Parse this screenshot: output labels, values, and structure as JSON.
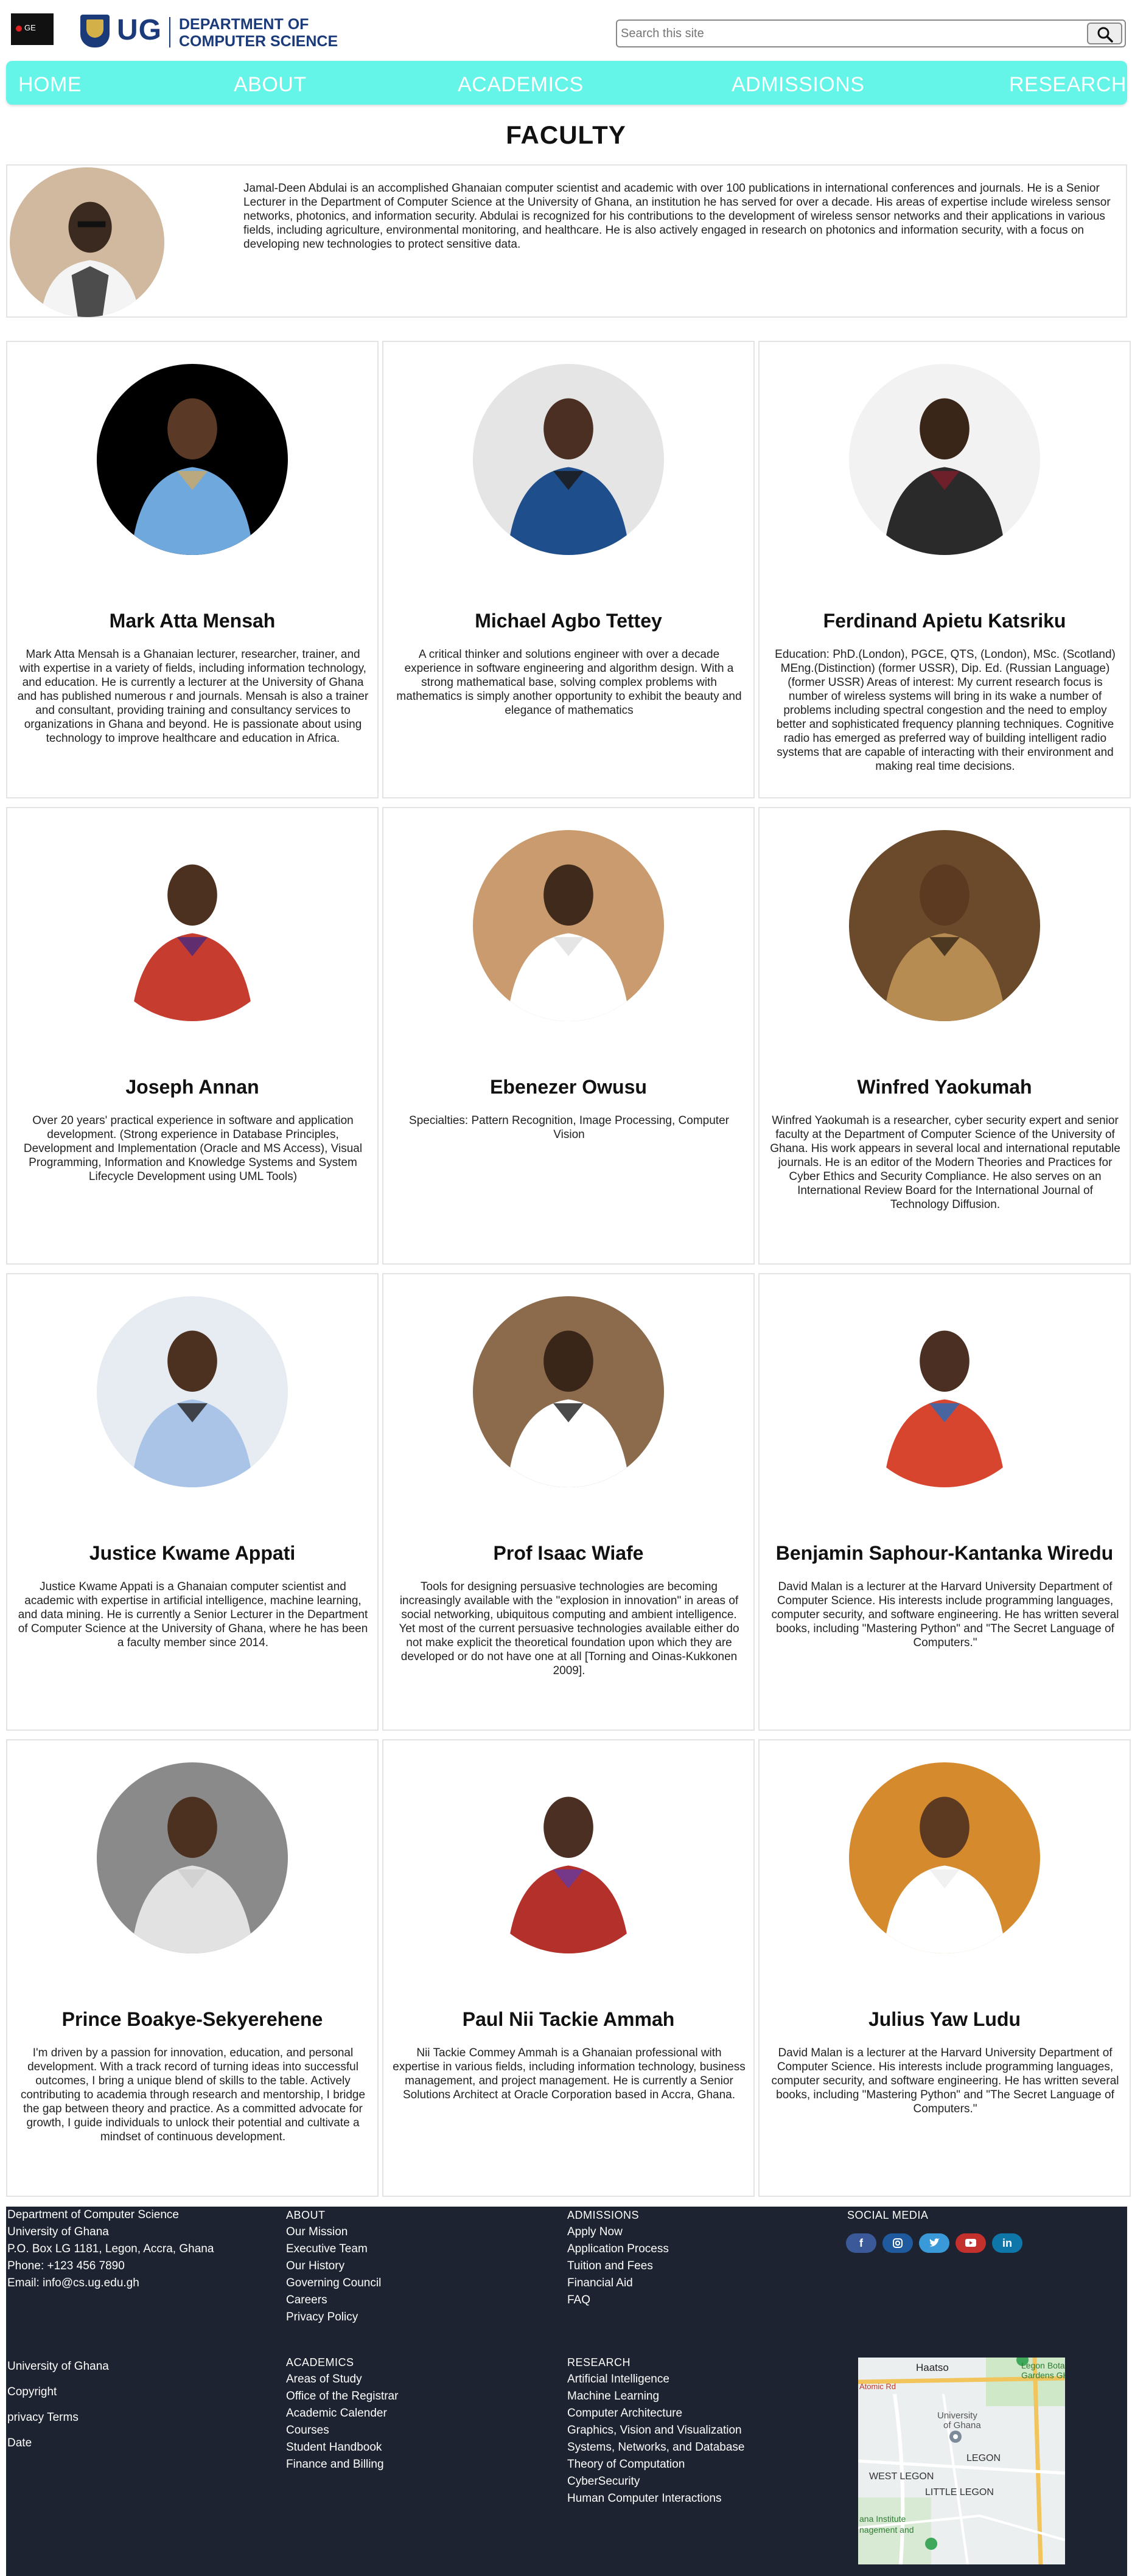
{
  "header": {
    "logo_badge": "GE",
    "ug": "UG",
    "dept_line1": "DEPARTMENT OF",
    "dept_line2": "COMPUTER SCIENCE",
    "search_placeholder": "Search this site"
  },
  "nav": {
    "items": [
      {
        "label": "HOME"
      },
      {
        "label": "ABOUT"
      },
      {
        "label": "ACADEMICS"
      },
      {
        "label": "ADMISSIONS"
      },
      {
        "label": "RESEARCH"
      }
    ]
  },
  "page_title": "FACULTY",
  "featured": {
    "bio": "Jamal-Deen Abdulai is an accomplished Ghanaian computer scientist and academic with over 100 publications in international conferences and journals. He is a Senior Lecturer in the Department of Computer Science at the University of Ghana, an institution he has served for over a decade. His areas of expertise include wireless sensor networks, photonics, and information security. Abdulai is recognized for his contributions to the development of wireless sensor networks and their applications in various fields, including agriculture, environmental monitoring, and healthcare. He is also actively engaged in research on photonics and information security, with a focus on developing new technologies to protect sensitive data."
  },
  "faculty": [
    {
      "name": "Mark Atta Mensah",
      "bio": "Mark Atta Mensah is a Ghanaian lecturer, researcher, trainer, and with expertise in a variety of fields, including information technology, and education. He is currently a lecturer at the University of Ghana and has published numerous r and journals. Mensah is also a trainer and consultant, providing training and consultancy services to organizations in Ghana and beyond. He is passionate about using technology to improve healthcare and education in Africa."
    },
    {
      "name": "Michael Agbo Tettey",
      "bio": "A critical thinker and solutions engineer with over a decade experience in software engineering and algorithm design. With a strong mathematical base, solving complex problems with mathematics is simply another opportunity to exhibit the beauty and elegance of mathematics"
    },
    {
      "name": "Ferdinand Apietu Katsriku",
      "bio": "Education: PhD.(London), PGCE, QTS, (London), MSc. (Scotland) MEng.(Distinction) (former USSR), Dip. Ed. (Russian Language) (former USSR) Areas of interest: My current research focus is number of wireless systems will bring in its wake a number of problems including spectral congestion and the need to employ better and sophisticated frequency planning techniques. Cognitive radio has emerged as preferred way of building intelligent radio systems that are capable of interacting with their environment and making real time decisions."
    },
    {
      "name": "Joseph Annan",
      "bio": "Over 20 years' practical experience in software and application development. (Strong experience in Database Principles, Development and Implementation (Oracle and MS Access), Visual Programming, Information and Knowledge Systems and System Lifecycle Development using UML Tools)"
    },
    {
      "name": "Ebenezer Owusu",
      "bio": "Specialties: Pattern Recognition, Image Processing, Computer Vision"
    },
    {
      "name": "Winfred Yaokumah",
      "bio": "Winfred Yaokumah is a researcher, cyber security expert and senior faculty at the Department of Computer Science of the University of Ghana. His work appears in several local and international reputable journals. He is an editor of the Modern Theories and Practices for Cyber Ethics and Security Compliance. He also serves on an International Review Board for the International Journal of Technology Diffusion."
    },
    {
      "name": "Justice Kwame Appati",
      "bio": "Justice Kwame Appati is a Ghanaian computer scientist and academic with expertise in artificial intelligence, machine learning, and data mining. He is currently a Senior Lecturer in the Department of Computer Science at the University of Ghana, where he has been a faculty member since 2014."
    },
    {
      "name": "Prof Isaac Wiafe",
      "bio": "Tools for designing persuasive technologies are becoming increasingly available with the \"explosion in innovation\" in areas of social networking, ubiquitous computing and ambient intelligence. Yet most of the current persuasive technologies available either do not make explicit the theoretical foundation upon which they are developed or do not have one at all [Torning and Oinas-Kukkonen 2009]."
    },
    {
      "name": "Benjamin Saphour-Kantanka Wiredu",
      "bio": "David Malan is a lecturer at the Harvard University Department of Computer Science. His interests include programming languages, computer security, and software engineering. He has written several books, including \"Mastering Python\" and \"The Secret Language of Computers.\""
    },
    {
      "name": "Prince Boakye-Sekyerehene",
      "bio": "I'm driven by a passion for innovation, education, and personal development. With a track record of turning ideas into successful outcomes, I bring a unique blend of skills to the table. Actively contributing to academia through research and mentorship, I bridge the gap between theory and practice. As a committed advocate for growth, I guide individuals to unlock their potential and cultivate a mindset of continuous development."
    },
    {
      "name": "Paul Nii Tackie Ammah",
      "bio": "Nii Tackie Commey Ammah is a Ghanaian professional with expertise in various fields, including information technology, business management, and project management. He is currently a Senior Solutions Architect at Oracle Corporation based in Accra, Ghana."
    },
    {
      "name": "Julius Yaw Ludu",
      "bio": "David Malan is a lecturer at the Harvard University Department of Computer Science. His interests include programming languages, computer security, and software engineering. He has written several books, including \"Mastering Python\" and \"The Secret Language of Computers.\""
    }
  ],
  "footer": {
    "contact": [
      "Department of Computer Science",
      "University of Ghana",
      "P.O. Box LG 1181, Legon, Accra, Ghana",
      "Phone: +123 456 7890",
      "Email: info@cs.ug.edu.gh"
    ],
    "about_heading": "ABOUT",
    "about_links": [
      "Our Mission",
      "Executive Team",
      "Our History",
      "Governing Council",
      "Careers",
      "Privacy Policy"
    ],
    "admissions_heading": "ADMISSIONS",
    "admissions_links": [
      "Apply Now",
      "Application Process",
      "Tuition and Fees",
      "Financial Aid",
      "FAQ"
    ],
    "social_heading": "SOCIAL MEDIA",
    "legal": [
      "University of Ghana",
      "Copyright",
      "privacy Terms",
      "Date"
    ],
    "academics_heading": "ACADEMICS",
    "academics_links": [
      "Areas of Study",
      "Office of the Registrar",
      "Academic Calender",
      "Courses",
      "Student Handbook",
      "Finance and Billing"
    ],
    "research_heading": "RESEARCH",
    "research_links": [
      "Artificial Intelligence",
      "Machine Learning",
      "Computer Architecture",
      "Graphics, Vision and Visualization",
      "Systems, Networks, and Database",
      "Theory of Computation",
      "CyberSecurity",
      "Human Computer Interactions"
    ],
    "map_labels": [
      "Haatso",
      "Legon Bota",
      "Gardens GH",
      "University",
      "of Ghana",
      "LEGON",
      "WEST LEGON",
      "LITTLE LEGON",
      "Atomic Rd",
      "ana Institute",
      "nagement and"
    ]
  },
  "colors": {
    "nav_bg": "#65f5e8",
    "brand_blue": "#1b3a7a",
    "footer_bg": "#1d2330"
  }
}
